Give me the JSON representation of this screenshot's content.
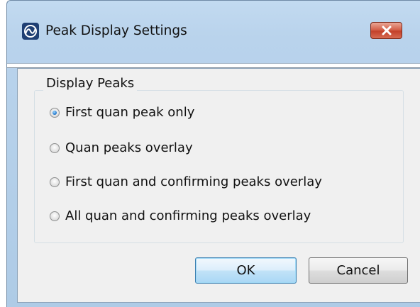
{
  "window": {
    "title": "Peak Display Settings"
  },
  "group": {
    "label": "Display Peaks",
    "options": [
      {
        "label": "First quan peak only",
        "checked": true
      },
      {
        "label": "Quan peaks overlay",
        "checked": false
      },
      {
        "label": "First quan and confirming peaks overlay",
        "checked": false
      },
      {
        "label": "All quan and confirming peaks overlay",
        "checked": false
      }
    ]
  },
  "buttons": {
    "ok": "OK",
    "cancel": "Cancel"
  },
  "colors": {
    "title_bg": "#b9d3ec",
    "close_red": "#c3412a",
    "dialog_bg": "#f0f0f0",
    "radio_accent": "#2a7fd0"
  },
  "icons": {
    "app": "app-logo-icon",
    "close": "close-icon"
  }
}
